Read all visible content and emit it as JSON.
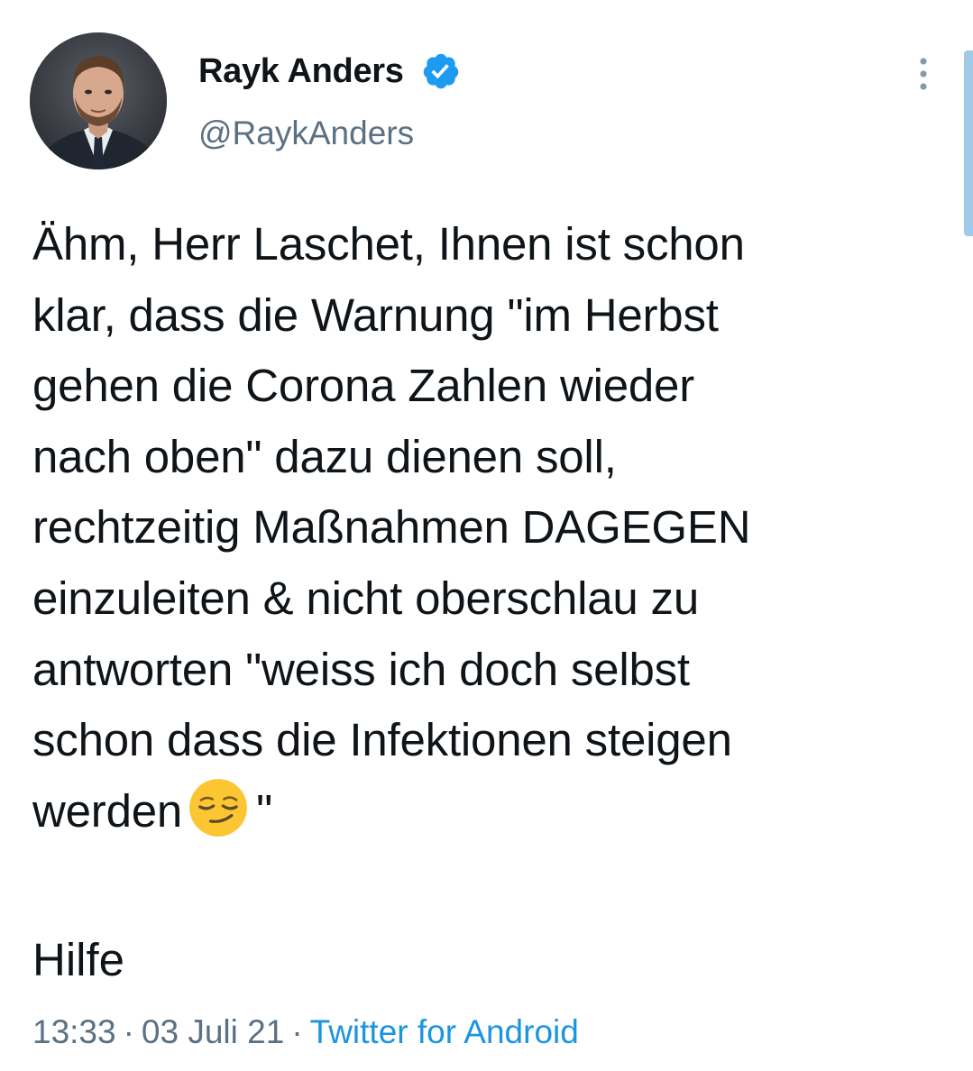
{
  "author": {
    "name": "Rayk Anders",
    "handle": "@RaykAnders",
    "verified": true
  },
  "tweet": {
    "text_main": "Ähm, Herr Laschet, Ihnen ist schon\nklar, dass die Warnung \"im Herbst\ngehen die Corona Zahlen wieder\nnach oben\" dazu dienen soll,\nrechtzeitig Maßnahmen DAGEGEN\neinzuleiten & nicht oberschlau zu\nantworten \"weiss ich doch selbst\nschon dass die Infektionen steigen\nwerden",
    "text_after_emoji": "\"",
    "emoji": "smirking-face",
    "text_second_paragraph": "Hilfe"
  },
  "meta": {
    "time": "13:33",
    "date": "03 Juli 21",
    "separator": "·",
    "source": "Twitter for Android"
  },
  "colors": {
    "text": "#0f1419",
    "secondary": "#5b7083",
    "accent": "#1b95e0",
    "verified_badge": "#1d9bf0"
  },
  "icons": {
    "verified": "verified-badge-icon",
    "more": "more-vertical-icon"
  }
}
